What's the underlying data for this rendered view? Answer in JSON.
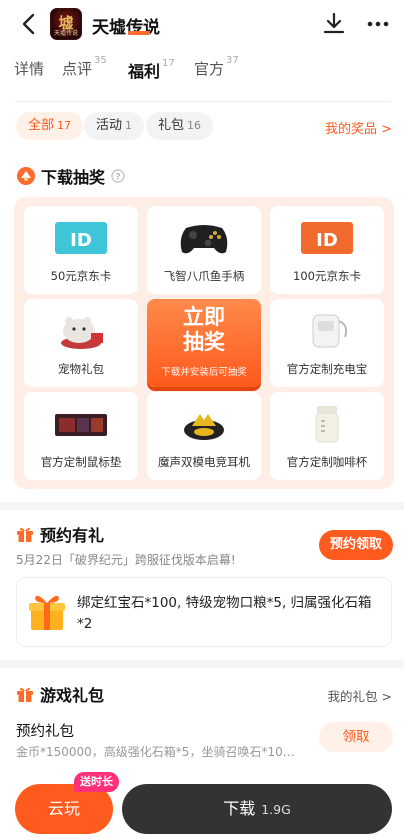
{
  "header": {
    "app_title": "天墟传说",
    "icon_glyph": "墟",
    "icon_mini": "天墟传说"
  },
  "tabs": [
    {
      "label": "详情",
      "count": ""
    },
    {
      "label": "点评",
      "count": "35"
    },
    {
      "label": "福利",
      "count": "17"
    },
    {
      "label": "官方",
      "count": "37"
    }
  ],
  "filters": [
    {
      "label": "全部",
      "count": "17"
    },
    {
      "label": "活动",
      "count": "1"
    },
    {
      "label": "礼包",
      "count": "16"
    }
  ],
  "my_prize_link": "我的奖品 >",
  "lottery": {
    "title": "下载抽奖",
    "prizes": [
      {
        "label": "50元京东卡",
        "icon": "jd-card-blue"
      },
      {
        "label": "飞智八爪鱼手柄",
        "icon": "gamepad"
      },
      {
        "label": "100元京东卡",
        "icon": "jd-card-orange"
      },
      {
        "label": "宠物礼包",
        "icon": "pet-bear"
      },
      {
        "label": "官方定制充电宝",
        "icon": "power-bank"
      },
      {
        "label": "官方定制鼠标垫",
        "icon": "mouse-pad"
      },
      {
        "label": "魔声双模电竞耳机",
        "icon": "earbuds"
      },
      {
        "label": "官方定制咖啡杯",
        "icon": "coffee-cup"
      }
    ],
    "draw_button": {
      "line1": "立即",
      "line2": "抽奖",
      "hint": "下载并安装后可抽奖"
    }
  },
  "reservation": {
    "title": "预约有礼",
    "subtitle": "5月22日「破界纪元」跨服征伐版本启幕!",
    "button": "预约领取",
    "reward": "绑定红宝石*100, 特级宠物口粮*5, 归属强化石箱*2"
  },
  "game_gifts": {
    "title": "游戏礼包",
    "my_gift_link": "我的礼包 >",
    "item": {
      "name": "预约礼包",
      "desc": "金币*150000，高级强化石箱*5，坐骑召唤石*10，...",
      "button": "领取"
    }
  },
  "bottom_bar": {
    "cloud_play": "云玩",
    "cloud_tag": "送时长",
    "download": "下载",
    "size": "1.9G"
  },
  "colors": {
    "accent": "#ff5b1f",
    "accent_light": "#fff0e8",
    "panel_bg": "#ffeee6",
    "dark_button": "#333333",
    "tag_pink": "#ff2f7a"
  }
}
